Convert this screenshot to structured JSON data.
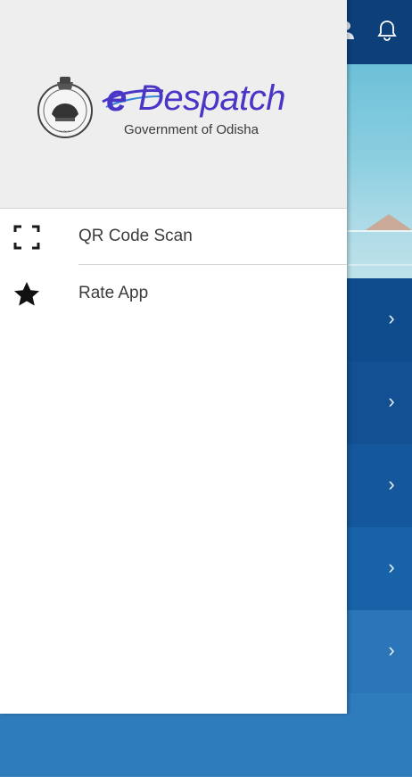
{
  "drawer": {
    "logo": {
      "brand_e": "e",
      "brand_rest": "Despatch",
      "subtitle": "Government of Odisha"
    },
    "items": [
      {
        "label": "QR Code Scan",
        "icon": "qr-scan-icon"
      },
      {
        "label": "Rate App",
        "icon": "star-icon"
      }
    ]
  },
  "background": {
    "topbar_icons": [
      "user-icon",
      "bell-icon"
    ],
    "rows_count_visible": 5,
    "colors": {
      "topbar": "#0d3f79",
      "rows": [
        "#0f4c8e",
        "#124f93",
        "#15579c",
        "#1863a8",
        "#2a76b8"
      ]
    }
  },
  "colors": {
    "brand": "#4a36c6",
    "header_bg": "#eeeeee",
    "text": "#3c3c3c"
  }
}
